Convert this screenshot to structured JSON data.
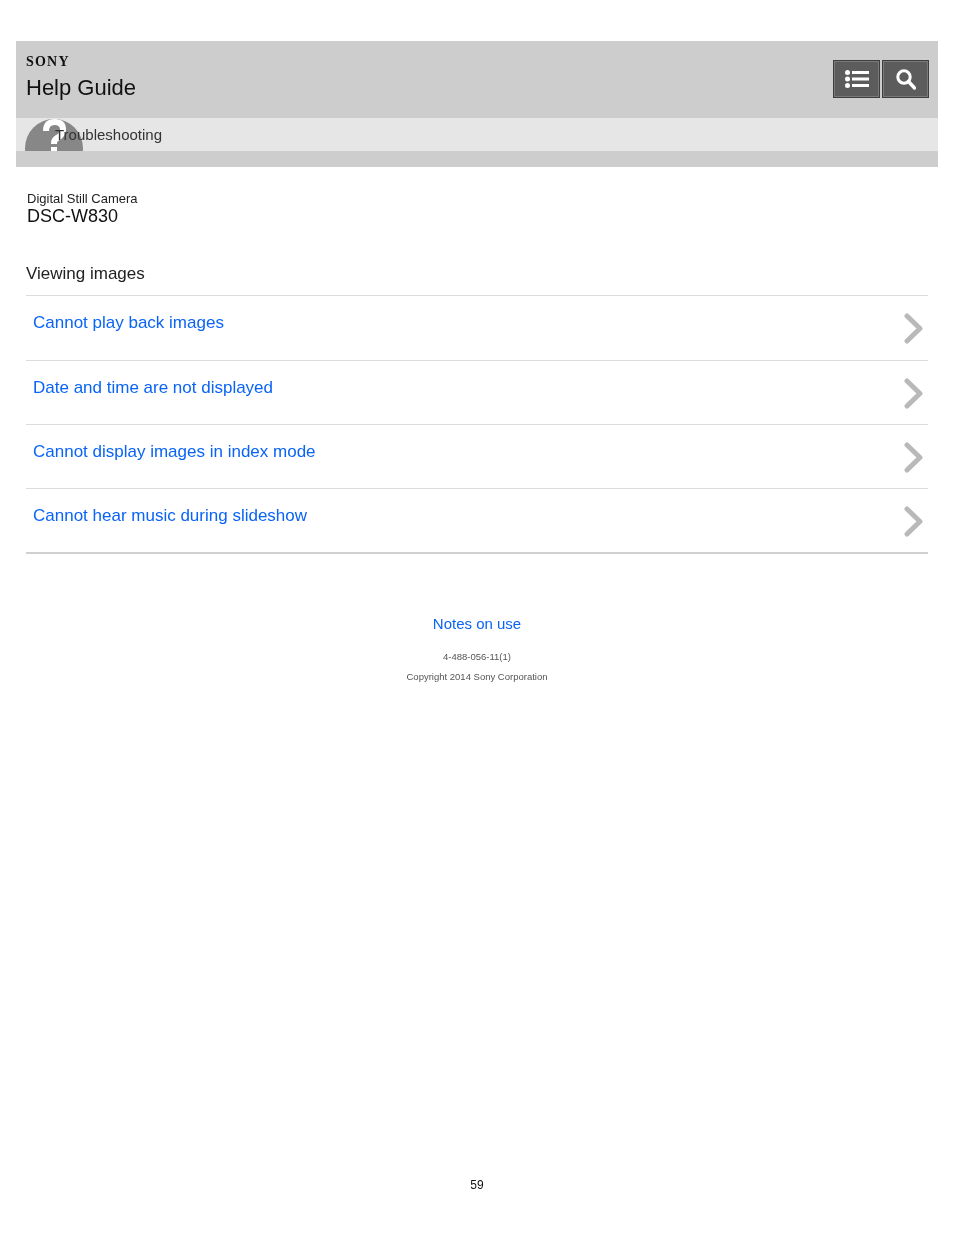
{
  "header": {
    "brand": "SONY",
    "title": "Help Guide",
    "buttons": [
      {
        "kind": "menu"
      },
      {
        "kind": "search"
      }
    ]
  },
  "breadcrumb": {
    "label": "Troubleshooting"
  },
  "product": {
    "category": "Digital Still Camera",
    "model": "DSC-W830"
  },
  "section": {
    "title": "Viewing images",
    "links": [
      {
        "label": "Cannot play back images"
      },
      {
        "label": "Date and time are not displayed"
      },
      {
        "label": "Cannot display images in index mode"
      },
      {
        "label": "Cannot hear music during slideshow"
      }
    ]
  },
  "footer": {
    "link": "Notes on use",
    "code": "4-488-056-11(1)",
    "copyright": "Copyright 2014 Sony Corporation"
  },
  "page_number": "59"
}
